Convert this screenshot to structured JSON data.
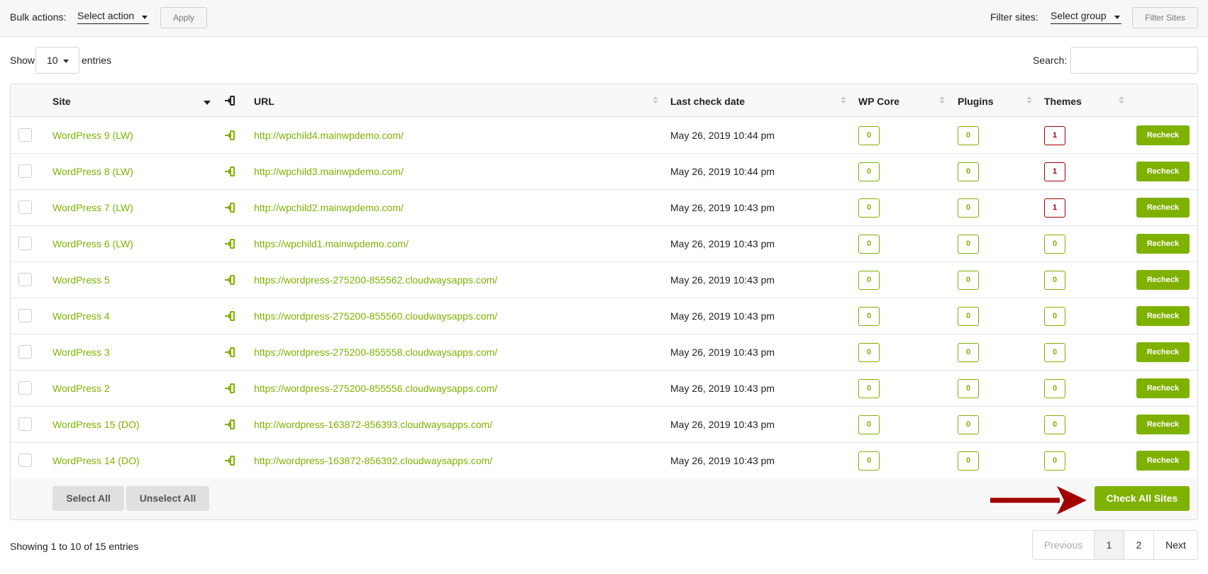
{
  "toolbar": {
    "bulk_label": "Bulk actions:",
    "bulk_select": "Select action",
    "apply": "Apply",
    "filter_label": "Filter sites:",
    "filter_select": "Select group",
    "filter_button": "Filter Sites"
  },
  "controls": {
    "show": "Show",
    "length": "10",
    "entries": "entries",
    "search_label": "Search:"
  },
  "columns": {
    "site": "Site",
    "url": "URL",
    "last_check": "Last check date",
    "wp_core": "WP Core",
    "plugins": "Plugins",
    "themes": "Themes"
  },
  "rows": [
    {
      "site": "WordPress 9 (LW)",
      "url": "http://wpchild4.mainwpdemo.com/",
      "date": "May 26, 2019 10:44 pm",
      "core": "0",
      "plugins": "0",
      "themes": "1",
      "recheck": "Recheck"
    },
    {
      "site": "WordPress 8 (LW)",
      "url": "http://wpchild3.mainwpdemo.com/",
      "date": "May 26, 2019 10:44 pm",
      "core": "0",
      "plugins": "0",
      "themes": "1",
      "recheck": "Recheck"
    },
    {
      "site": "WordPress 7 (LW)",
      "url": "http://wpchild2.mainwpdemo.com/",
      "date": "May 26, 2019 10:43 pm",
      "core": "0",
      "plugins": "0",
      "themes": "1",
      "recheck": "Recheck"
    },
    {
      "site": "WordPress 6 (LW)",
      "url": "https://wpchild1.mainwpdemo.com/",
      "date": "May 26, 2019 10:43 pm",
      "core": "0",
      "plugins": "0",
      "themes": "0",
      "recheck": "Recheck"
    },
    {
      "site": "WordPress 5",
      "url": "https://wordpress-275200-855562.cloudwaysapps.com/",
      "date": "May 26, 2019 10:43 pm",
      "core": "0",
      "plugins": "0",
      "themes": "0",
      "recheck": "Recheck"
    },
    {
      "site": "WordPress 4",
      "url": "https://wordpress-275200-855560.cloudwaysapps.com/",
      "date": "May 26, 2019 10:43 pm",
      "core": "0",
      "plugins": "0",
      "themes": "0",
      "recheck": "Recheck"
    },
    {
      "site": "WordPress 3",
      "url": "https://wordpress-275200-855558.cloudwaysapps.com/",
      "date": "May 26, 2019 10:43 pm",
      "core": "0",
      "plugins": "0",
      "themes": "0",
      "recheck": "Recheck"
    },
    {
      "site": "WordPress 2",
      "url": "https://wordpress-275200-855556.cloudwaysapps.com/",
      "date": "May 26, 2019 10:43 pm",
      "core": "0",
      "plugins": "0",
      "themes": "0",
      "recheck": "Recheck"
    },
    {
      "site": "WordPress 15 (DO)",
      "url": "http://wordpress-163872-856393.cloudwaysapps.com/",
      "date": "May 26, 2019 10:43 pm",
      "core": "0",
      "plugins": "0",
      "themes": "0",
      "recheck": "Recheck"
    },
    {
      "site": "WordPress 14 (DO)",
      "url": "http://wordpress-163872-856392.cloudwaysapps.com/",
      "date": "May 26, 2019 10:43 pm",
      "core": "0",
      "plugins": "0",
      "themes": "0",
      "recheck": "Recheck"
    }
  ],
  "footer": {
    "select_all": "Select All",
    "unselect_all": "Unselect All",
    "check_all": "Check All Sites"
  },
  "info": "Showing 1 to 10 of 15 entries",
  "pagination": {
    "previous": "Previous",
    "pages": [
      "1",
      "2"
    ],
    "next": "Next"
  },
  "colors": {
    "accent_green": "#7fb100",
    "warning_red": "#a30000",
    "arrow_red": "#a30000"
  },
  "icons": {
    "login": "sign-in-icon",
    "sort": "sort-icon",
    "arrow": "right-arrow-annotation"
  }
}
